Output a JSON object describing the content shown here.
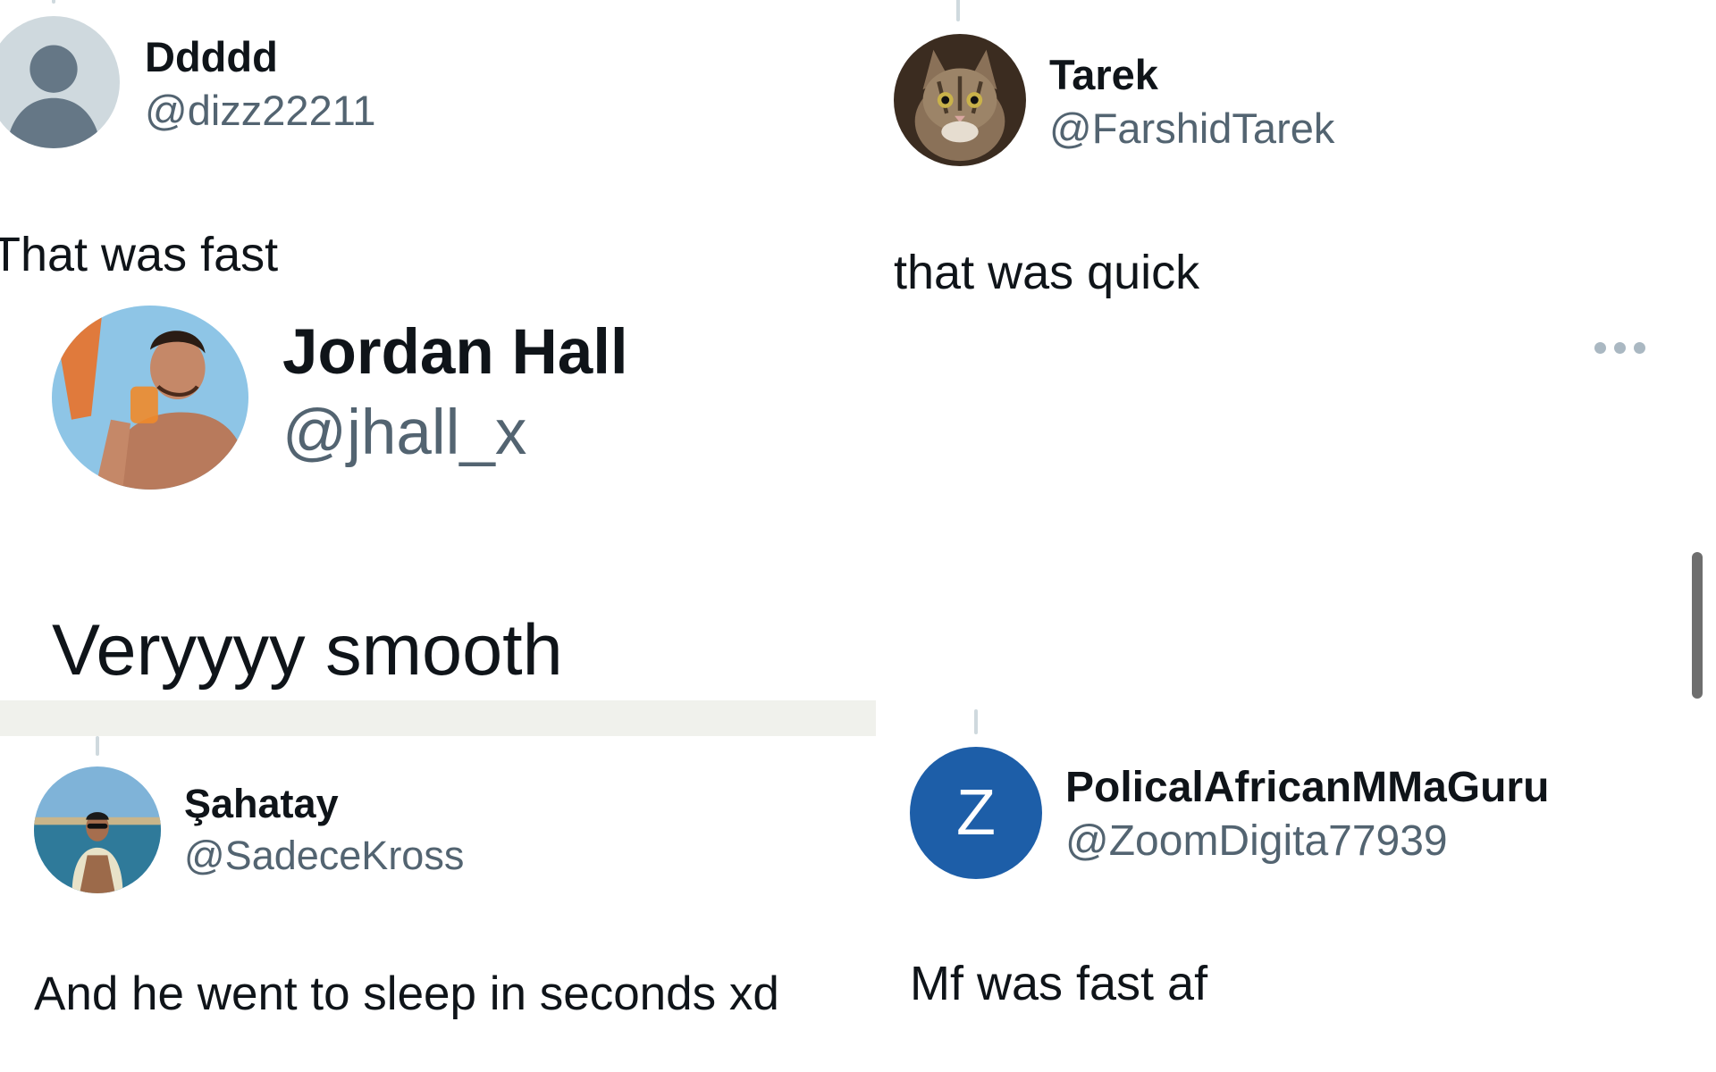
{
  "tweets": [
    {
      "name": "Ddddd",
      "handle": "@dizz22211",
      "text": "That was fast",
      "avatar": "default-person-avatar"
    },
    {
      "name": "Tarek",
      "handle": "@FarshidTarek",
      "text": "that was quick",
      "avatar": "kitten-photo-avatar"
    },
    {
      "name": "Jordan Hall",
      "handle": "@jhall_x",
      "text": "Veryyyy smooth",
      "avatar": "man-with-drink-photo-avatar"
    },
    {
      "name": "Şahatay",
      "handle": "@SadeceKross",
      "text": "And he went to sleep in seconds xd",
      "avatar": "man-by-water-photo-avatar"
    },
    {
      "name": "PolicalAfricanMMaGuru",
      "handle": "@ZoomDigita77939",
      "text": "Mf was fast af",
      "avatar": "letter-avatar",
      "avatar_letter": "Z"
    }
  ],
  "colors": {
    "name_text": "#0f1419",
    "handle_text": "#536471",
    "thread_line": "#cfd9de",
    "letter_avatar_bg": "#1d5ea8",
    "default_avatar_bg": "#cfd9de",
    "default_avatar_fg": "#657786"
  },
  "icons": {
    "more_menu": "more-horizontal-icon",
    "scrollbar": "scrollbar-thumb"
  }
}
